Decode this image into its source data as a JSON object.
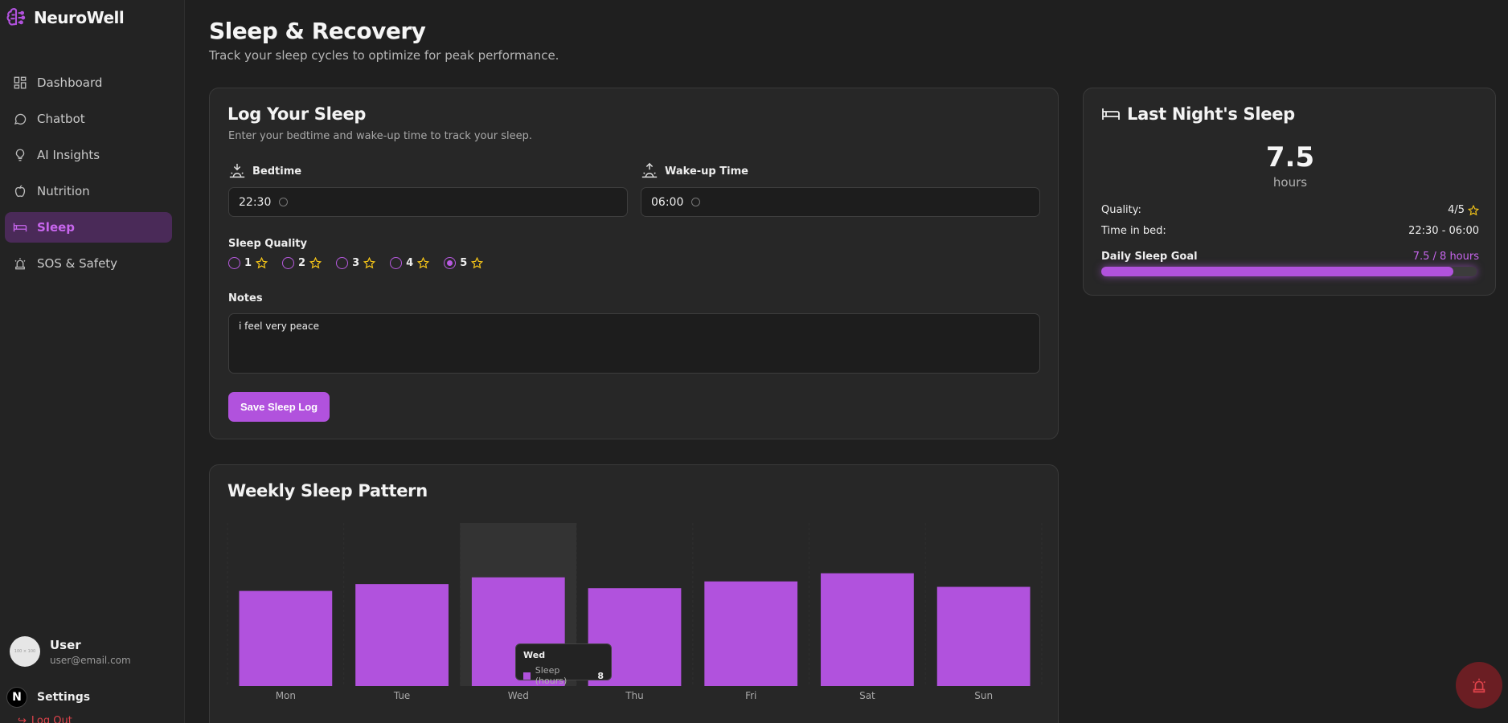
{
  "brand": {
    "name": "NeuroWell"
  },
  "sidebar": {
    "items": [
      {
        "label": "Dashboard",
        "icon": "dashboard-icon"
      },
      {
        "label": "Chatbot",
        "icon": "chat-icon"
      },
      {
        "label": "AI Insights",
        "icon": "lightbulb-icon"
      },
      {
        "label": "Nutrition",
        "icon": "apple-icon"
      },
      {
        "label": "Sleep",
        "icon": "bed-icon",
        "active": true
      },
      {
        "label": "SOS & Safety",
        "icon": "siren-icon"
      }
    ],
    "user": {
      "name": "User",
      "email": "user@email.com",
      "avatar_text": "100 × 100"
    },
    "settings_label": "Settings",
    "settings_badge": "N",
    "logout_label": "Log Out"
  },
  "header": {
    "title": "Sleep & Recovery",
    "subtitle": "Track your sleep cycles to optimize for peak performance."
  },
  "log_card": {
    "title": "Log Your Sleep",
    "subtitle": "Enter your bedtime and wake-up time to track your sleep.",
    "bedtime_label": "Bedtime",
    "bedtime_value": "22:30",
    "wakeup_label": "Wake-up Time",
    "wakeup_value": "06:00",
    "quality_label": "Sleep Quality",
    "quality_options": [
      "1",
      "2",
      "3",
      "4",
      "5"
    ],
    "quality_selected": "5",
    "notes_label": "Notes",
    "notes_value": "i feel very peace",
    "save_label": "Save Sleep Log"
  },
  "night_card": {
    "title": "Last Night's Sleep",
    "hours": "7.5",
    "hours_unit": "hours",
    "quality_label": "Quality:",
    "quality_value": "4/5",
    "time_in_bed_label": "Time in bed:",
    "time_in_bed_value": "22:30 - 06:00",
    "goal_label": "Daily Sleep Goal",
    "goal_value": "7.5 / 8 hours",
    "goal_fraction": 0.9375
  },
  "chart_card": {
    "title": "Weekly Sleep Pattern",
    "tooltip": {
      "day": "Wed",
      "series": "Sleep (hours)",
      "value": "8"
    }
  },
  "chart_data": {
    "type": "bar",
    "title": "Weekly Sleep Pattern",
    "categories": [
      "Mon",
      "Tue",
      "Wed",
      "Thu",
      "Fri",
      "Sat",
      "Sun"
    ],
    "series": [
      {
        "name": "Sleep (hours)",
        "values": [
          7.0,
          7.5,
          8.0,
          7.2,
          7.7,
          8.3,
          7.3
        ]
      }
    ],
    "ylim": [
      0,
      12
    ],
    "color": "#b152dd",
    "grid": true
  },
  "colors": {
    "accent": "#b152dd",
    "active_bg": "#4a2a58",
    "danger": "#e0434b",
    "star": "#f5c518"
  }
}
